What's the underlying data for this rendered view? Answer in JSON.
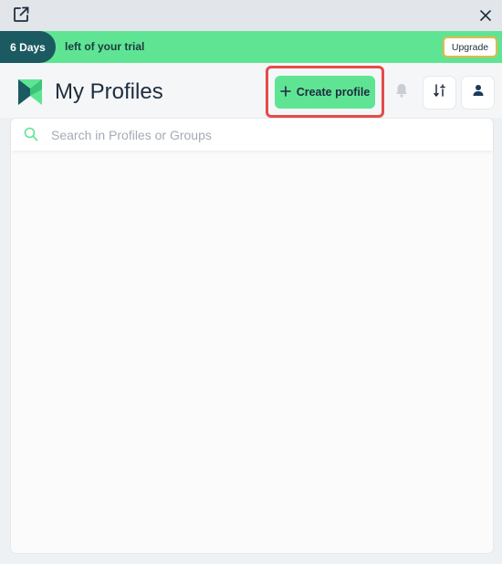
{
  "window": {
    "popout_icon": "external-link-icon",
    "close_icon": "close-icon"
  },
  "trial": {
    "days_label": "6 Days",
    "message": "left of your trial",
    "upgrade_label": "Upgrade"
  },
  "header": {
    "title": "My Profiles",
    "logo_icon": "app-logo",
    "create_label": "Create profile",
    "create_icon": "plus-icon",
    "notifications_icon": "bell-icon",
    "filter_icon": "sort-filter-icon",
    "account_icon": "user-icon"
  },
  "search": {
    "placeholder": "Search in Profiles or Groups",
    "value": ""
  },
  "colors": {
    "accent_green": "#5fe494",
    "days_pill": "#1a5a60",
    "upgrade_border": "#e8b84a",
    "highlight_red": "#e54b4b"
  }
}
